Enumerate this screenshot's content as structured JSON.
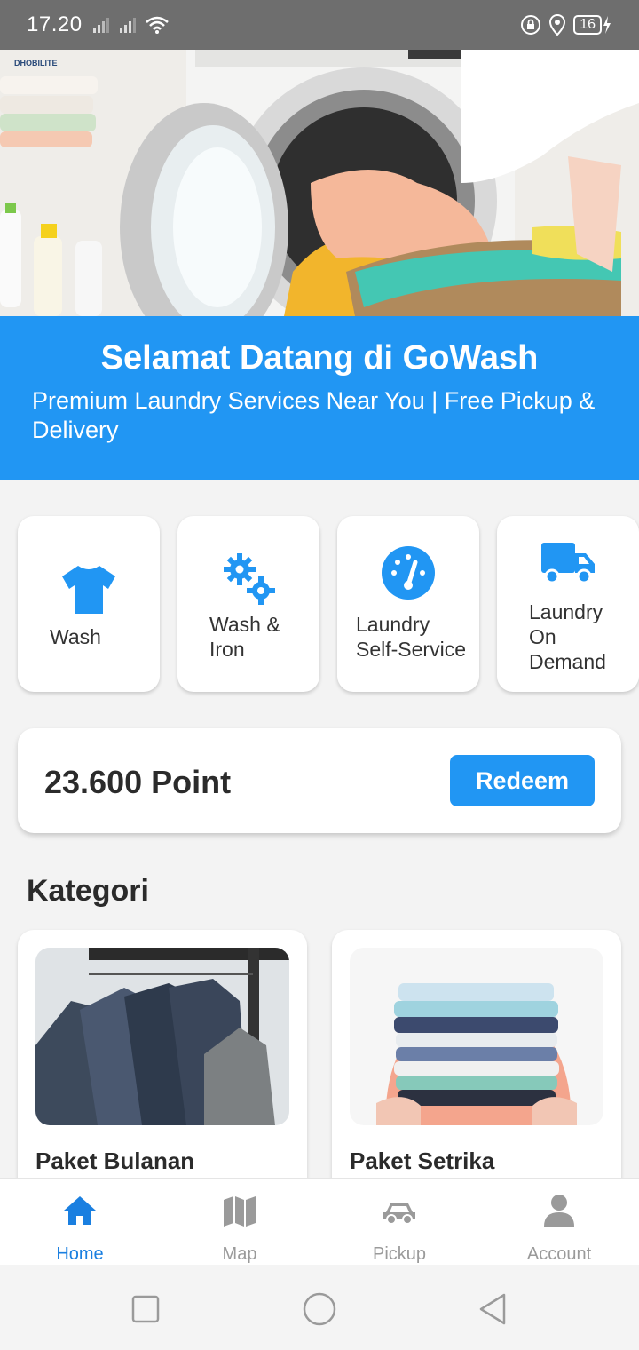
{
  "status_bar": {
    "time": "17.20",
    "battery": "16"
  },
  "hero": {
    "brand": "DHOBILITE"
  },
  "banner": {
    "title": "Selamat Datang di GoWash",
    "subtitle": "Premium Laundry Services Near You | Free Pickup & Delivery"
  },
  "services": [
    {
      "label": "Wash",
      "icon": "tshirt-icon"
    },
    {
      "label": "Wash & Iron",
      "icon": "gears-icon"
    },
    {
      "label": "Laundry Self-Service",
      "icon": "gauge-icon"
    },
    {
      "label": "Laundry On Demand",
      "icon": "truck-icon"
    }
  ],
  "points": {
    "value": "23.600 Point",
    "redeem_label": "Redeem"
  },
  "kategori": {
    "title": "Kategori",
    "items": [
      {
        "name": "Paket Bulanan"
      },
      {
        "name": "Paket Setrika"
      }
    ]
  },
  "bottom_nav": [
    {
      "label": "Home",
      "icon": "home-icon",
      "active": true
    },
    {
      "label": "Map",
      "icon": "map-icon",
      "active": false
    },
    {
      "label": "Pickup",
      "icon": "car-icon",
      "active": false
    },
    {
      "label": "Account",
      "icon": "user-icon",
      "active": false
    }
  ],
  "colors": {
    "primary": "#2196f3",
    "active_nav": "#1a7fe0",
    "inactive_nav": "#9a9a9a"
  }
}
